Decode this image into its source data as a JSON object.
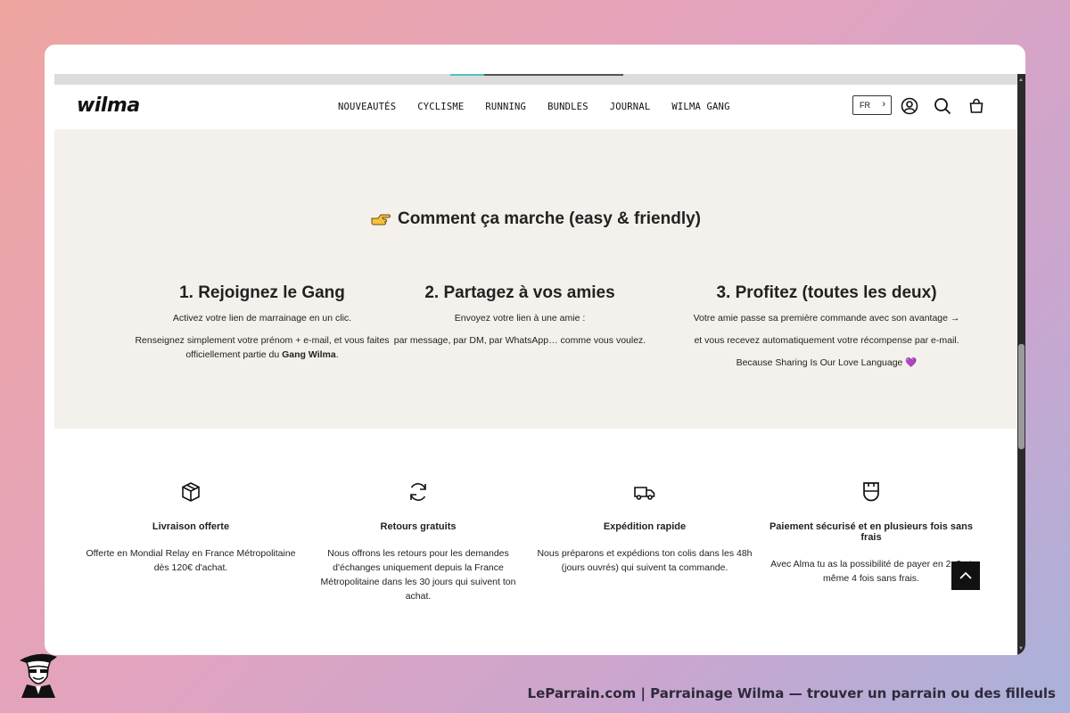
{
  "header": {
    "logo": "wilma",
    "nav": [
      "NOUVEAUTÉS",
      "CYCLISME",
      "RUNNING",
      "BUNDLES",
      "JOURNAL",
      "WILMA GANG"
    ],
    "language": "FR",
    "icons": [
      "account-icon",
      "search-icon",
      "cart-icon"
    ]
  },
  "hero": {
    "title": "Comment ça marche (easy & friendly)",
    "steps": [
      {
        "title": "1. Rejoignez le Gang",
        "line1": "Activez votre lien de marrainage en un clic.",
        "line2a": "Renseignez simplement votre prénom + e-mail, et vous faites officiellement partie du ",
        "line2b": "Gang Wilma",
        "line2c": "."
      },
      {
        "title": "2. Partagez à vos amies",
        "line1": "Envoyez votre lien à une amie :",
        "line2": "par message, par DM, par WhatsApp… comme vous voulez."
      },
      {
        "title": "3. Profitez (toutes les deux)",
        "line1": "Votre amie passe sa première commande avec son avantage →",
        "line2": "et vous recevez automatiquement votre récompense par e-mail.",
        "line3": "Because Sharing Is Our Love Language 💜"
      }
    ]
  },
  "features": [
    {
      "icon": "package-icon",
      "title": "Livraison offerte",
      "text": "Offerte en Mondial Relay en France Métropolitaine dès 120€ d'achat."
    },
    {
      "icon": "refresh-icon",
      "title": "Retours gratuits",
      "text": "Nous offrons les retours pour les demandes d'échanges uniquement depuis la France Métropolitaine dans les 30 jours qui suivent ton achat."
    },
    {
      "icon": "truck-icon",
      "title": "Expédition rapide",
      "text": "Nous préparons et expédions ton colis dans les 48h (jours ouvrés) qui suivent ta commande."
    },
    {
      "icon": "shield-icon",
      "title": "Paiement sécurisé et en plusieurs fois sans frais",
      "text": "Avec Alma tu as la possibilité de payer en 2, 3 et même 4 fois sans frais."
    }
  ],
  "caption": "LeParrain.com | Parrainage Wilma — trouver un parrain ou des filleuls",
  "colors": {
    "hero_bg": "#f4f1ec",
    "accent": "#4fc1c1",
    "text": "#222222"
  }
}
